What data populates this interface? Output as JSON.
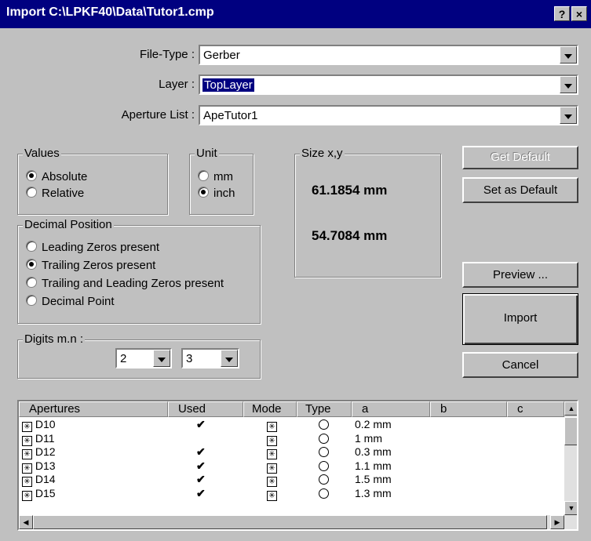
{
  "title": {
    "text": "Import   C:\\LPKF40\\Data\\Tutor1.cmp",
    "help": "?",
    "close": "×"
  },
  "fields": {
    "file_type_label": "File-Type :",
    "file_type_value": "Gerber",
    "layer_label": "Layer :",
    "layer_value": "TopLayer",
    "aperture_list_label": "Aperture List :",
    "aperture_list_value": "ApeTutor1"
  },
  "values_group": {
    "title": "Values",
    "options": [
      "Absolute",
      "Relative"
    ],
    "selected": "Absolute"
  },
  "unit_group": {
    "title": "Unit",
    "options": [
      "mm",
      "inch"
    ],
    "selected": "inch"
  },
  "size_group": {
    "title": "Size x,y",
    "x": "61.1854 mm",
    "y": "54.7084 mm"
  },
  "decimal_group": {
    "title": "Decimal Position",
    "options": [
      "Leading Zeros present",
      "Trailing Zeros present",
      "Trailing and Leading Zeros present",
      "Decimal Point"
    ],
    "selected": "Trailing Zeros present"
  },
  "digits_group": {
    "title": "Digits  m.n :",
    "m": "2",
    "n": "3"
  },
  "buttons": {
    "get_default": "Get Default",
    "set_default": "Set as Default",
    "preview": "Preview ...",
    "import": "Import",
    "cancel": "Cancel"
  },
  "table": {
    "headers": [
      "Apertures",
      "Used",
      "Mode",
      "Type",
      "a",
      "b",
      "c"
    ],
    "rows": [
      {
        "name": "D10",
        "used": "✔",
        "a": "0.2 mm"
      },
      {
        "name": "D11",
        "used": "",
        "a": "1 mm"
      },
      {
        "name": "D12",
        "used": "✔",
        "a": "0.3 mm"
      },
      {
        "name": "D13",
        "used": "✔",
        "a": "1.1 mm"
      },
      {
        "name": "D14",
        "used": "✔",
        "a": "1.5 mm"
      },
      {
        "name": "D15",
        "used": "✔",
        "a": "1.3 mm"
      }
    ]
  },
  "icons": {
    "aperture": "aperture-star-icon",
    "mode": "mode-icon",
    "type": "circle-shape-icon",
    "check": "checkmark-icon"
  }
}
